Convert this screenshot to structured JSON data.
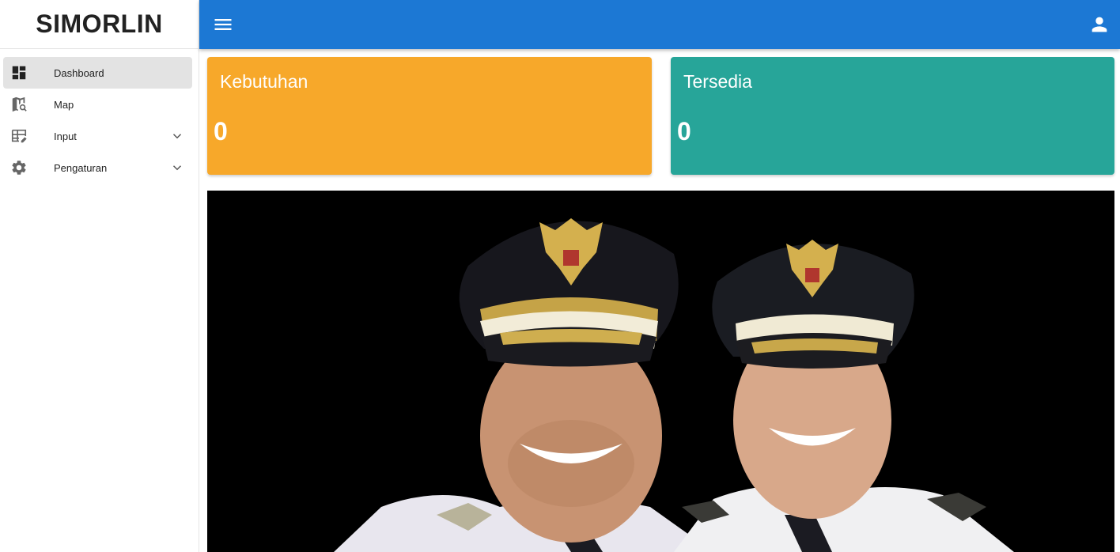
{
  "app": {
    "title": "SIMORLIN"
  },
  "sidebar": {
    "items": [
      {
        "label": "Dashboard",
        "icon": "dashboard-icon",
        "active": true
      },
      {
        "label": "Map",
        "icon": "map-search-icon"
      },
      {
        "label": "Input",
        "icon": "table-edit-icon",
        "expandable": true
      },
      {
        "label": "Pengaturan",
        "icon": "gear-icon",
        "expandable": true
      }
    ]
  },
  "header": {
    "menu_icon": "hamburger-menu-icon",
    "user_icon": "account-icon",
    "color": "#1c78d4"
  },
  "cards": [
    {
      "title": "Kebutuhan",
      "value": "0",
      "color": "#f7a82a"
    },
    {
      "title": "Tersedia",
      "value": "0",
      "color": "#27a599"
    }
  ],
  "banner": {
    "image": "portrait-photo-two-officials",
    "background": "#000000"
  }
}
